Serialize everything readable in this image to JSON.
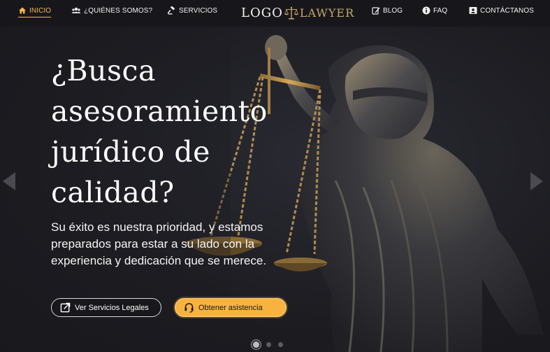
{
  "nav": {
    "items": [
      {
        "label": "INICIO",
        "icon": "home-icon",
        "active": true
      },
      {
        "label": "¿QUIÉNES SOMOS?",
        "icon": "users-icon"
      },
      {
        "label": "SERVICIOS",
        "icon": "gavel-icon"
      },
      {
        "label": "BLOG",
        "icon": "edit-icon"
      },
      {
        "label": "FAQ",
        "icon": "info-icon"
      },
      {
        "label": "CONTÁCTANOS",
        "icon": "contact-card-icon"
      }
    ],
    "logo": {
      "part1": "LOGO",
      "part2": "LAWYER",
      "icon": "scales-icon"
    }
  },
  "hero": {
    "title": "¿Busca asesoramiento jurídico de calidad?",
    "subtitle": "Su éxito es nuestra prioridad, y estamos preparados para estar a su lado con la experiencia y dedicación que se merece.",
    "buttons": {
      "primary": {
        "label": "Ver Servicios Legales",
        "icon": "external-link-icon"
      },
      "secondary": {
        "label": "Obtener asistencia",
        "icon": "headset-icon"
      }
    },
    "slider": {
      "slides": 3,
      "active": 1
    }
  },
  "colors": {
    "accent": "#f8b33f",
    "background": "#1d1d22",
    "logo_gold": "#c9a46a"
  }
}
